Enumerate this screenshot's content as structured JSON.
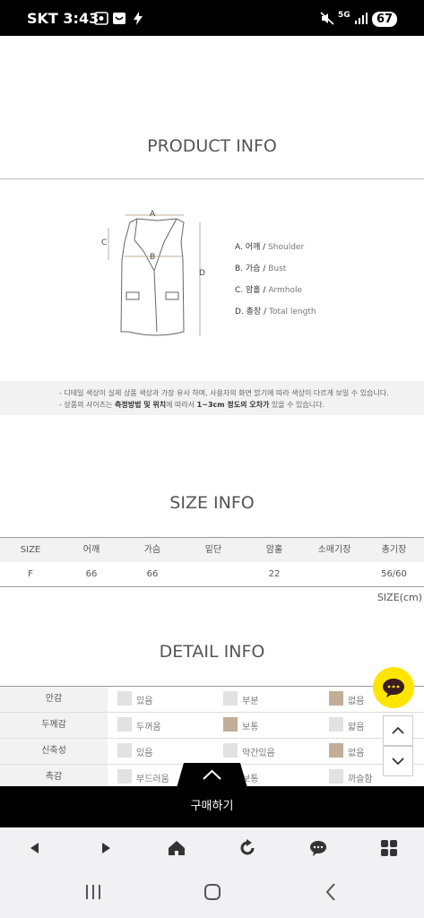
{
  "status_bar": {
    "carrier_time": "SKT 3:43",
    "network": "5G",
    "battery": "67"
  },
  "product_info": {
    "title": "PRODUCT INFO",
    "diagram_letters": [
      "A",
      "B",
      "C",
      "D"
    ],
    "measurements": [
      {
        "ko": "A. 어깨 /",
        "en": "Shoulder"
      },
      {
        "ko": "B. 가슴 /",
        "en": "Bust"
      },
      {
        "ko": "C. 암홀 /",
        "en": "Armhole"
      },
      {
        "ko": "D. 총장 /",
        "en": "Total length"
      }
    ]
  },
  "notice": {
    "line1": "- 디테일 색상이 실제 상품 색상과 가장 유사 하며, 사용자의 화면 밝기에 따라 색상이 다르게 보일 수 있습니다.",
    "line2_a": "- 상품의 사이즈는 ",
    "line2_b": "측정방법 및 위치",
    "line2_c": "에 따라서 ",
    "line2_d": "1~3cm 정도의 오차가",
    "line2_e": "  있을 수 있습니다."
  },
  "size_info": {
    "title": "SIZE INFO",
    "headers": [
      "SIZE",
      "어깨",
      "가슴",
      "밑단",
      "암홀",
      "소매기장",
      "총기장"
    ],
    "rows": [
      [
        "F",
        "66",
        "66",
        "",
        "22",
        "",
        "56/60"
      ]
    ],
    "unit": "SIZE(cm)"
  },
  "detail_info": {
    "title": "DETAIL INFO",
    "rows": [
      {
        "label": "안감",
        "options": [
          "있음",
          "부분",
          "없음"
        ],
        "selected": 2
      },
      {
        "label": "두께감",
        "options": [
          "두꺼움",
          "보통",
          "얇음"
        ],
        "selected": 1
      },
      {
        "label": "신축성",
        "options": [
          "있음",
          "약간있음",
          "없음"
        ],
        "selected": 2
      },
      {
        "label": "촉감",
        "options": [
          "부드러움",
          "보통",
          "까슬함"
        ],
        "selected": -1
      }
    ]
  },
  "buy_bar": {
    "label": "구매하기"
  },
  "colors": {
    "selected_box": "#c2ae96",
    "kakao_yellow": "#fee500"
  }
}
